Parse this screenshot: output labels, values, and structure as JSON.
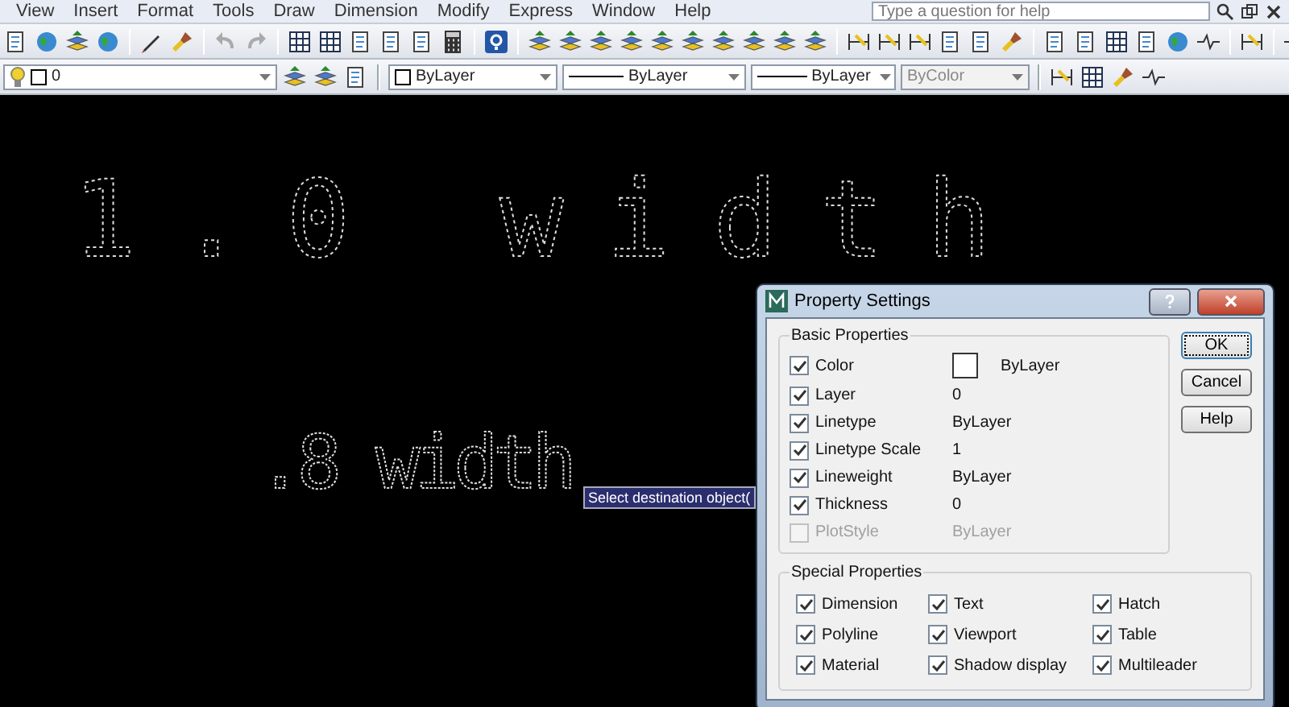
{
  "menu": [
    "View",
    "Insert",
    "Format",
    "Tools",
    "Draw",
    "Dimension",
    "Modify",
    "Express",
    "Window",
    "Help"
  ],
  "help_search": {
    "placeholder": "Type a question for help"
  },
  "combos": [
    {
      "kind": "layer",
      "value": "0",
      "disabled": false
    },
    {
      "kind": "color",
      "value": "ByLayer",
      "disabled": false
    },
    {
      "kind": "linetype",
      "value": "ByLayer",
      "disabled": false
    },
    {
      "kind": "lineweight",
      "value": "ByLayer",
      "disabled": false
    },
    {
      "kind": "plotstyle",
      "value": "ByColor",
      "disabled": true
    }
  ],
  "drawing": {
    "texts": [
      {
        "text": "1.0 width",
        "kind": "wide"
      },
      {
        "text": ".8 width",
        "kind": "narrow"
      }
    ],
    "tooltip": "Select destination object("
  },
  "dialog": {
    "title": "Property Settings",
    "basic": {
      "title": "Basic Properties",
      "rows": [
        {
          "label": "Color",
          "value": "ByLayer",
          "kind": "swatch",
          "checked": true,
          "disabled": false
        },
        {
          "label": "Layer",
          "value": "0",
          "kind": "text",
          "checked": true,
          "disabled": false
        },
        {
          "label": "Linetype",
          "value": "ByLayer",
          "kind": "text",
          "checked": true,
          "disabled": false
        },
        {
          "label": "Linetype Scale",
          "value": "1",
          "kind": "text",
          "checked": true,
          "disabled": false
        },
        {
          "label": "Lineweight",
          "value": "ByLayer",
          "kind": "text",
          "checked": true,
          "disabled": false
        },
        {
          "label": "Thickness",
          "value": "0",
          "kind": "text",
          "checked": true,
          "disabled": false
        },
        {
          "label": "PlotStyle",
          "value": "ByLayer",
          "kind": "text",
          "checked": false,
          "disabled": true
        }
      ]
    },
    "special": {
      "title": "Special Properties",
      "items": [
        {
          "label": "Dimension",
          "checked": true
        },
        {
          "label": "Text",
          "checked": true
        },
        {
          "label": "Hatch",
          "checked": true
        },
        {
          "label": "Polyline",
          "checked": true
        },
        {
          "label": "Viewport",
          "checked": true
        },
        {
          "label": "Table",
          "checked": true
        },
        {
          "label": "Material",
          "checked": true
        },
        {
          "label": "Shadow display",
          "checked": true
        },
        {
          "label": "Multileader",
          "checked": true
        }
      ]
    },
    "buttons": [
      {
        "label": "OK",
        "default": true
      },
      {
        "label": "Cancel",
        "default": false
      },
      {
        "label": "Help",
        "default": false
      }
    ]
  }
}
